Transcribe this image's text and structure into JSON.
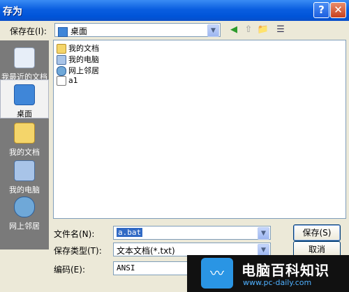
{
  "window": {
    "title": "存为",
    "help_glyph": "?",
    "close_glyph": "✕"
  },
  "save_in": {
    "label": "保存在(I):",
    "value": "桌面"
  },
  "toolbar": {
    "back_glyph": "◀",
    "up_glyph": "⇧",
    "newfolder_glyph": "📁",
    "view_glyph": "☰"
  },
  "places": [
    {
      "label": "我最近的文档",
      "icon": "recent-documents-icon"
    },
    {
      "label": "桌面",
      "icon": "desktop-icon",
      "selected": true
    },
    {
      "label": "我的文档",
      "icon": "my-documents-icon"
    },
    {
      "label": "我的电脑",
      "icon": "my-computer-icon"
    },
    {
      "label": "网上邻居",
      "icon": "network-places-icon"
    }
  ],
  "files": [
    {
      "name": "我的文档",
      "icon": "folder-icon"
    },
    {
      "name": "我的电脑",
      "icon": "computer-icon"
    },
    {
      "name": "网上邻居",
      "icon": "network-icon"
    },
    {
      "name": "a1",
      "icon": "text-file-icon"
    }
  ],
  "filename": {
    "label": "文件名(N):",
    "value": "a.bat"
  },
  "filetype": {
    "label": "保存类型(T):",
    "value": "文本文档(*.txt)"
  },
  "encoding": {
    "label": "编码(E):",
    "value": "ANSI"
  },
  "buttons": {
    "save": "保存(S)",
    "cancel": "取消"
  },
  "watermark": {
    "title": "电脑百科知识",
    "url": "www.pc-daily.com",
    "logo_glyph": "〰"
  },
  "colors": {
    "titlebar": "#0054d8",
    "dialog": "#ece9d8",
    "selection": "#316ac5"
  }
}
